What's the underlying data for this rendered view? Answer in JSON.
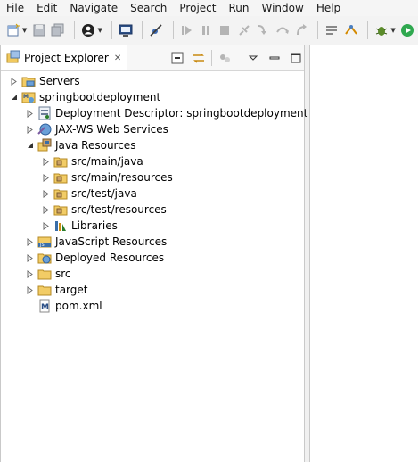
{
  "menu": [
    "File",
    "Edit",
    "Navigate",
    "Search",
    "Project",
    "Run",
    "Window",
    "Help"
  ],
  "toolbar_icons": [
    "new-icon",
    "save-icon",
    "save-all-icon",
    "profile-icon",
    "console-icon",
    "skip-breakpoints-icon",
    "resume-icon",
    "suspend-icon",
    "terminate-icon",
    "disconnect-icon",
    "step-into-icon",
    "step-over-icon",
    "step-return-icon",
    "toggle-mark-occurrences-icon",
    "open-task-icon",
    "debug-icon",
    "run-icon"
  ],
  "panel": {
    "tab_label": "Project Explorer",
    "tab_close": "✕"
  },
  "tree": [
    {
      "label": "Servers",
      "icon": "folder-server-icon",
      "depth": 0,
      "state": "collapsed"
    },
    {
      "label": "springbootdeployment",
      "icon": "maven-web-project-icon",
      "depth": 0,
      "state": "expanded"
    },
    {
      "label": "Deployment Descriptor: springbootdeployment",
      "icon": "deployment-descriptor-icon",
      "depth": 1,
      "state": "collapsed"
    },
    {
      "label": "JAX-WS Web Services",
      "icon": "web-services-icon",
      "depth": 1,
      "state": "collapsed"
    },
    {
      "label": "Java Resources",
      "icon": "java-resources-icon",
      "depth": 1,
      "state": "expanded"
    },
    {
      "label": "src/main/java",
      "icon": "source-folder-icon",
      "depth": 2,
      "state": "collapsed"
    },
    {
      "label": "src/main/resources",
      "icon": "source-folder-icon",
      "depth": 2,
      "state": "collapsed"
    },
    {
      "label": "src/test/java",
      "icon": "source-folder-icon",
      "depth": 2,
      "state": "collapsed"
    },
    {
      "label": "src/test/resources",
      "icon": "source-folder-icon",
      "depth": 2,
      "state": "collapsed"
    },
    {
      "label": "Libraries",
      "icon": "libraries-icon",
      "depth": 2,
      "state": "collapsed"
    },
    {
      "label": "JavaScript Resources",
      "icon": "javascript-resources-icon",
      "depth": 1,
      "state": "collapsed"
    },
    {
      "label": "Deployed Resources",
      "icon": "deployed-resources-icon",
      "depth": 1,
      "state": "collapsed"
    },
    {
      "label": "src",
      "icon": "folder-icon",
      "depth": 1,
      "state": "collapsed"
    },
    {
      "label": "target",
      "icon": "folder-icon",
      "depth": 1,
      "state": "collapsed"
    },
    {
      "label": "pom.xml",
      "icon": "maven-pom-icon",
      "depth": 1,
      "state": "leaf"
    }
  ]
}
